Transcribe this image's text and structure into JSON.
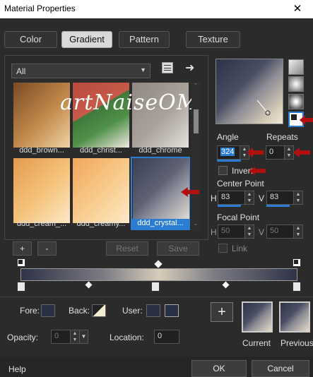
{
  "window": {
    "title": "Material Properties",
    "close": "✕"
  },
  "tabs": [
    {
      "label": "Color"
    },
    {
      "label": "Gradient",
      "active": true
    },
    {
      "label": "Pattern"
    },
    {
      "label": "Texture"
    }
  ],
  "category": {
    "selected": "All"
  },
  "swatches": [
    {
      "label": "ddd_brown...",
      "colors": [
        "#7a4a25",
        "#c28a4b",
        "#f0d3a6"
      ]
    },
    {
      "label": "ddd_christ...",
      "colors": [
        "#b84a3e",
        "#3f7a3c",
        "#f2e8e2"
      ]
    },
    {
      "label": "ddd_chrome",
      "colors": [
        "#8f8881",
        "#c7c2bc",
        "#e5e1dd"
      ]
    },
    {
      "label": "ddd_cream_...",
      "colors": [
        "#e59a4e",
        "#f5c47d",
        "#fde8c8"
      ]
    },
    {
      "label": "ddd_creamy...",
      "colors": [
        "#f2a65c",
        "#f8cd8e",
        "#fde9c9"
      ]
    },
    {
      "label": "ddd_crystal...",
      "colors": [
        "#3a3f55",
        "#8d8f9c",
        "#e8e2d6"
      ],
      "selected": true
    }
  ],
  "watermark": "artNaiseOM",
  "buttons": {
    "plus": "+",
    "minus": "-",
    "reset": "Reset",
    "save": "Save"
  },
  "angle": {
    "label": "Angle",
    "value": "324"
  },
  "repeats": {
    "label": "Repeats",
    "value": "0"
  },
  "invert": {
    "label": "Invert",
    "checked": false
  },
  "center_point": {
    "label": "Center Point",
    "h_label": "H",
    "h_value": "83",
    "v_label": "V",
    "v_value": "83"
  },
  "focal_point": {
    "label": "Focal Point",
    "h_label": "H",
    "h_value": "50",
    "v_label": "V",
    "v_value": "50"
  },
  "link": {
    "label": "Link"
  },
  "swatch_row": {
    "fore_label": "Fore:",
    "back_label": "Back:",
    "user_label": "User:",
    "opacity_label": "Opacity:",
    "opacity_value": "0",
    "location_label": "Location:",
    "location_value": "0"
  },
  "preview": {
    "current_label": "Current",
    "previous_label": "Previous",
    "add": "+"
  },
  "footer": {
    "help": "Help",
    "ok": "OK",
    "cancel": "Cancel"
  },
  "colors": {
    "accent": "#2a7dd3",
    "arrow_red": "#b01010",
    "gradient_dark": "#2f3346",
    "gradient_light": "#d8cdbb"
  }
}
